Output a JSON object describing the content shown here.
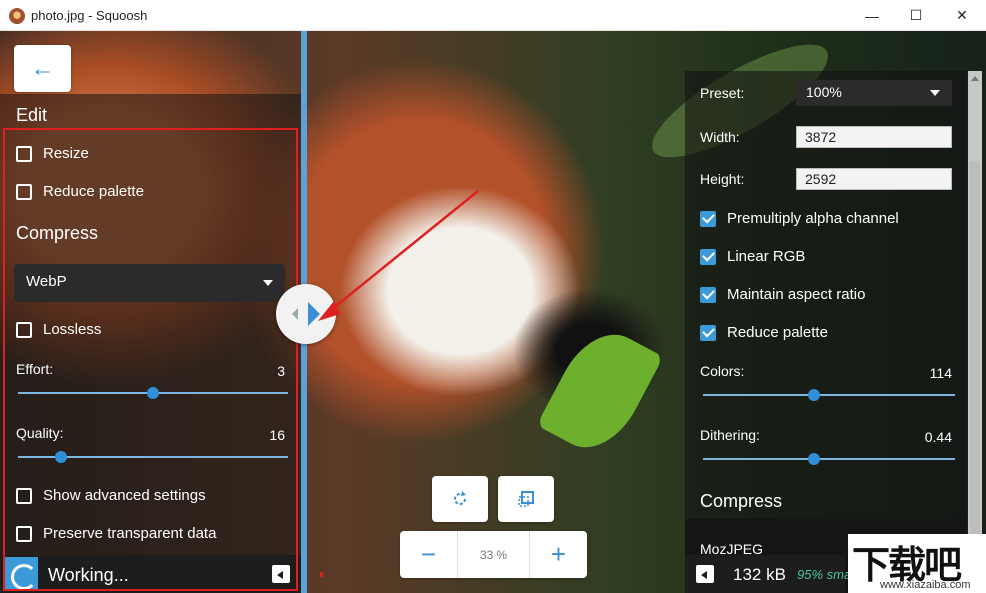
{
  "window": {
    "title": "photo.jpg - Squoosh",
    "minimize_glyph": "—",
    "maximize_glyph": "☐",
    "close_glyph": "✕"
  },
  "left_panel": {
    "back_glyph": "←",
    "edit_heading": "Edit",
    "resize_label": "Resize",
    "resize_checked": false,
    "reduce_palette_label": "Reduce palette",
    "reduce_palette_checked": false,
    "compress_heading": "Compress",
    "codec_selected": "WebP",
    "lossless_label": "Lossless",
    "lossless_checked": false,
    "effort_label": "Effort:",
    "effort_value": "3",
    "effort_fraction": 0.5,
    "quality_label": "Quality:",
    "quality_value": "16",
    "quality_fraction": 0.16,
    "advanced_label": "Show advanced settings",
    "advanced_checked": false,
    "preserve_label": "Preserve transparent data",
    "preserve_checked": false,
    "status_text": "Working..."
  },
  "right_panel": {
    "preset_label": "Preset:",
    "preset_value": "100%",
    "width_label": "Width:",
    "width_value": "3872",
    "height_label": "Height:",
    "height_value": "2592",
    "premultiply_label": "Premultiply alpha channel",
    "linear_rgb_label": "Linear RGB",
    "maintain_aspect_label": "Maintain aspect ratio",
    "reduce_palette_label": "Reduce palette",
    "colors_label": "Colors:",
    "colors_value": "114",
    "colors_fraction": 0.44,
    "dithering_label": "Dithering:",
    "dithering_value": "0.44",
    "dithering_fraction": 0.44,
    "compress_heading": "Compress",
    "codec_selected": "MozJPEG",
    "size_text": "132 kB",
    "smaller_text": "95% smaller"
  },
  "toolbar": {
    "zoom_value": "33",
    "zoom_unit": "%",
    "zoom_out_glyph": "−",
    "zoom_in_glyph": "+"
  },
  "watermark": {
    "big_text": "下载吧",
    "small_text": "www.xiazaiba.com"
  },
  "colors": {
    "accent": "#3d9ad9",
    "highlight": "#e02020",
    "savings": "#4fc3a1"
  }
}
